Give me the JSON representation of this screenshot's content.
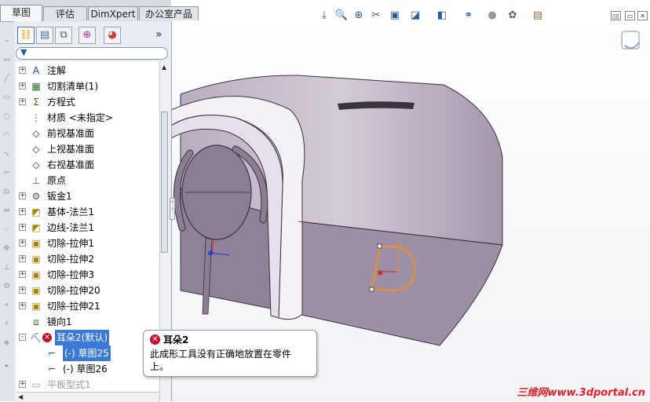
{
  "tabs": [
    "草图",
    "评估",
    "DimXpert",
    "办公室产品"
  ],
  "active_tab": "草图",
  "manager_tabs": [
    "feature-manager",
    "property-manager",
    "configuration-manager",
    "dimxpert-manager",
    "display-manager"
  ],
  "panel_collapse_glyph": "»",
  "filter_icon": "filter-icon",
  "tree": [
    {
      "label": "注解",
      "icon": "annotations-icon",
      "expand": "+"
    },
    {
      "label": "切割清单(1)",
      "icon": "cut-list-icon",
      "expand": "+"
    },
    {
      "label": "方程式",
      "icon": "equations-icon",
      "expand": "+"
    },
    {
      "label": "材质 <未指定>",
      "icon": "material-icon",
      "expand": ""
    },
    {
      "label": "前视基准面",
      "icon": "plane-icon",
      "expand": ""
    },
    {
      "label": "上视基准面",
      "icon": "plane-icon",
      "expand": ""
    },
    {
      "label": "右视基准面",
      "icon": "plane-icon",
      "expand": ""
    },
    {
      "label": "原点",
      "icon": "origin-icon",
      "expand": ""
    },
    {
      "label": "钣金1",
      "icon": "sheet-metal-icon",
      "expand": "+"
    },
    {
      "label": "基体-法兰1",
      "icon": "base-flange-icon",
      "expand": "+"
    },
    {
      "label": "边线-法兰1",
      "icon": "edge-flange-icon",
      "expand": "+"
    },
    {
      "label": "切除-拉伸1",
      "icon": "cut-extrude-icon",
      "expand": "+"
    },
    {
      "label": "切除-拉伸2",
      "icon": "cut-extrude-icon",
      "expand": "+"
    },
    {
      "label": "切除-拉伸3",
      "icon": "cut-extrude-icon",
      "expand": "+"
    },
    {
      "label": "切除-拉伸20",
      "icon": "cut-extrude-icon",
      "expand": "+"
    },
    {
      "label": "切除-拉伸21",
      "icon": "cut-extrude-icon",
      "expand": "+"
    },
    {
      "label": "镜向1",
      "icon": "mirror-icon",
      "expand": ""
    },
    {
      "label": "耳朵2(默认)",
      "icon": "forming-tool-icon",
      "expand": "-",
      "error": true,
      "selected": true
    },
    {
      "label": "(-) 草图25",
      "icon": "sketch-icon",
      "expand": "",
      "child": true,
      "selected": true
    },
    {
      "label": "(-) 草图26",
      "icon": "sketch-icon",
      "expand": "",
      "child": true
    },
    {
      "label": "平板型式1",
      "icon": "flat-pattern-icon",
      "expand": "+",
      "disabled": true
    }
  ],
  "tooltip": {
    "title": "耳朵2",
    "body": "此成形工具没有正确地放置在零件上。"
  },
  "view_toolbar": [
    "zoom-to-fit-icon",
    "zoom-area-icon",
    "zoom-in-out-icon",
    "section-view-icon",
    "view-orientation-icon",
    "display-style-icon",
    "hide-show-icon",
    "edit-appearance-icon",
    "apply-scene-icon",
    "view-settings-icon"
  ],
  "watermark": "三维网www.3dportal.cn",
  "colors": {
    "part_purple": "#9d8fa6",
    "part_light": "#cfc6d4",
    "sketch_orange": "#e8902a",
    "selection_blue": "#3b79d6",
    "error_red": "#c8102e"
  }
}
